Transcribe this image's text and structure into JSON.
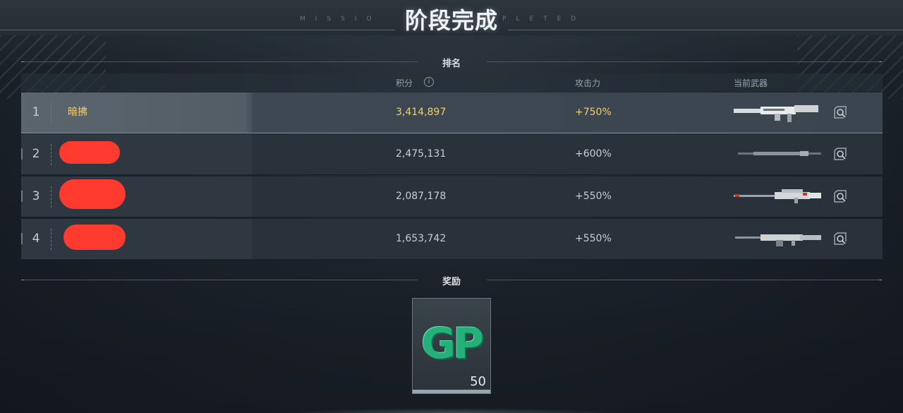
{
  "header": {
    "title": "阶段完成",
    "sub_left": "MISSIO",
    "sub_right": "PLETED"
  },
  "ranking": {
    "section_label": "排名",
    "columns": {
      "score": "积分",
      "attack": "攻击力",
      "weapon": "当前武器"
    },
    "info_icon": "i",
    "rows": [
      {
        "rank": "1",
        "name": "暗拂",
        "score": "3,414,897",
        "attack": "+750%",
        "weapon_icon": "heavy-rifle-icon",
        "highlighted": true
      },
      {
        "rank": "2",
        "name": "",
        "score": "2,475,131",
        "attack": "+600%",
        "weapon_icon": "sniper-rifle-icon",
        "highlighted": false
      },
      {
        "rank": "3",
        "name": "",
        "score": "2,087,178",
        "attack": "+550%",
        "weapon_icon": "sniper-rifle-red-icon",
        "highlighted": false
      },
      {
        "rank": "4",
        "name": "",
        "score": "1,653,742",
        "attack": "+550%",
        "weapon_icon": "machine-gun-icon",
        "highlighted": false
      }
    ]
  },
  "rewards": {
    "section_label": "奖励",
    "items": [
      {
        "icon": "gp-currency-icon",
        "logo": "GP",
        "quantity": "50"
      }
    ]
  },
  "colors": {
    "highlight_text": "#f1cf6a",
    "redaction": "#ff3b30",
    "gp_green": "#25b07a"
  }
}
